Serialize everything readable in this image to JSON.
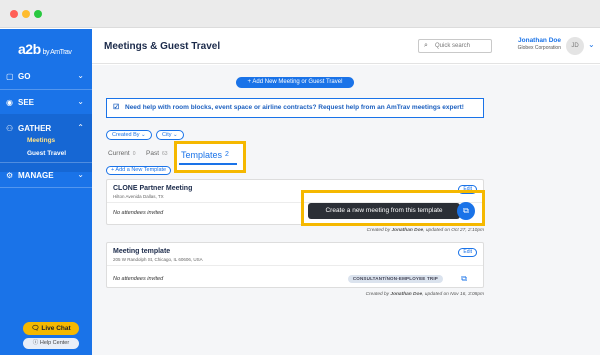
{
  "window": {
    "controls": [
      "close",
      "minimize",
      "maximize"
    ]
  },
  "sidebar": {
    "logo": "a2b",
    "logo_sub": "by AmTrav",
    "groups": [
      {
        "label": "GO",
        "icon": "suitcase-icon",
        "chevron": "⌄"
      },
      {
        "label": "SEE",
        "icon": "eye-icon",
        "chevron": "⌄"
      },
      {
        "label": "GATHER",
        "icon": "people-icon",
        "chevron": "⌃"
      },
      {
        "label": "MANAGE",
        "icon": "gear-icon",
        "chevron": "⌄"
      }
    ],
    "gather_items": [
      "Meetings",
      "Guest Travel"
    ],
    "live_chat": "Live Chat",
    "help_center": "Help Center"
  },
  "header": {
    "title": "Meetings & Guest Travel",
    "search_placeholder": "Quick search",
    "user_name": "Jonathan Doe",
    "user_org": "Globex Corporation",
    "avatar_initials": "JD"
  },
  "main": {
    "add_button": "+ Add New Meeting or Guest Travel",
    "banner": "Need help with room blocks, event space or airline contracts? Request help from an AmTrav meetings expert!",
    "filters": [
      "Created By",
      "City"
    ],
    "tabs": [
      {
        "label": "Current",
        "count": "0"
      },
      {
        "label": "Past",
        "count": "63"
      },
      {
        "label": "Templates",
        "count": "2"
      }
    ],
    "add_template": "+ Add a New Template",
    "templates": [
      {
        "title": "CLONE Partner Meeting",
        "address": "Hilton Avenida Dallas, TX",
        "edit": "Edit",
        "attendees": "No attendees invited",
        "badge": "",
        "created_prefix": "Created by ",
        "created_by": "Jonathan Doe",
        "created_suffix": ", updated on Oct 27, 2:10pm"
      },
      {
        "title": "Meeting template",
        "address": "205 W Randolph St, Chicago, IL 60606, USA",
        "edit": "Edit",
        "attendees": "No attendees invited",
        "badge": "CONSULTANT/NON-EMPLOYEE TRIP",
        "created_prefix": "Created by ",
        "created_by": "Jonathan Doe",
        "created_suffix": ", updated on Nov 16, 3:08pm"
      }
    ],
    "tooltip": "Create a new meeting from this template"
  },
  "colors": {
    "accent": "#1a73e8",
    "highlight": "#f5b800",
    "sidebar": "#1a73e8"
  }
}
